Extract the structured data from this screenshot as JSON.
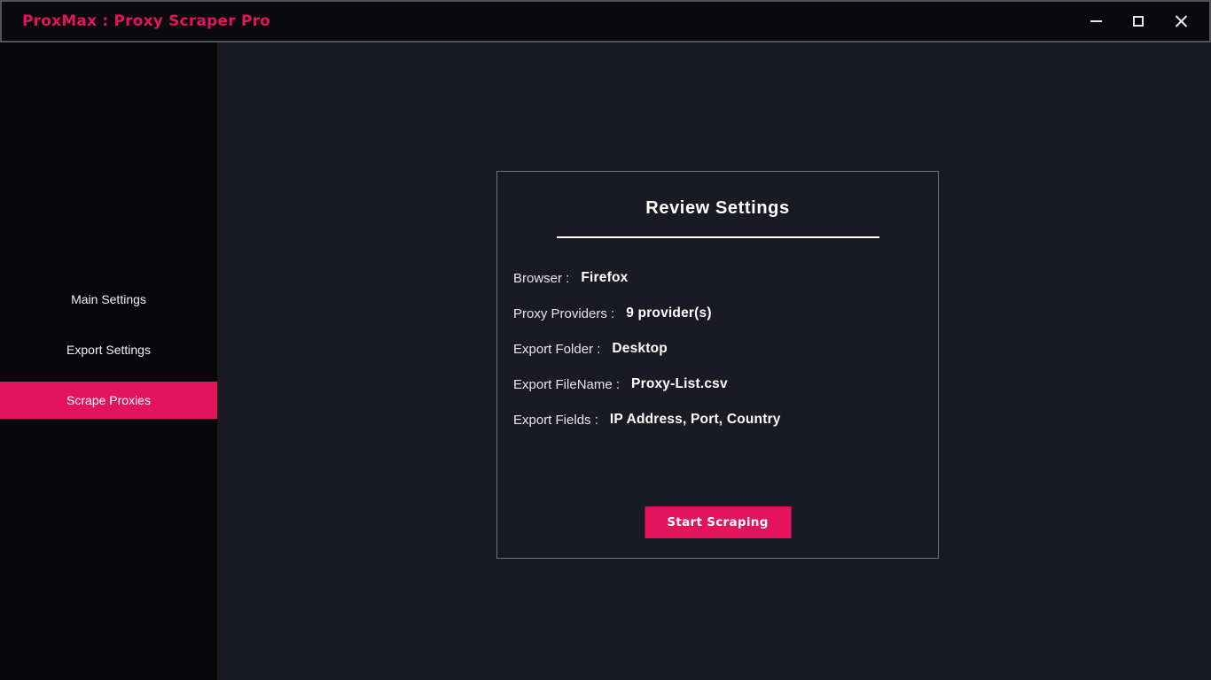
{
  "window": {
    "title": "ProxMax : Proxy Scraper Pro",
    "controls": {
      "minimize_icon": "minus-line",
      "maximize_icon": "square-outline",
      "close_icon": "x-cross"
    }
  },
  "sidebar": {
    "items": [
      {
        "label": "Main Settings",
        "active": false
      },
      {
        "label": "Export Settings",
        "active": false
      },
      {
        "label": "Scrape Proxies",
        "active": true
      }
    ]
  },
  "main": {
    "card": {
      "title": "Review Settings",
      "fields": [
        {
          "label": "Browser :",
          "value": "Firefox"
        },
        {
          "label": "Proxy Providers :",
          "value": "9 provider(s)"
        },
        {
          "label": "Export Folder :",
          "value": "Desktop"
        },
        {
          "label": "Export FileName :",
          "value": "Proxy-List.csv"
        },
        {
          "label": "Export Fields :",
          "value": "IP Address, Port, Country"
        }
      ],
      "start_button_label": "Start Scraping"
    }
  },
  "colors": {
    "accent": "#e4145c",
    "titlebar_bg": "#0a0a0e",
    "titlebar_border": "#53535a",
    "sidebar_bg": "#07070b",
    "main_bg": "#1a1a24",
    "card_border": "#73737c",
    "text_primary": "#ffffff",
    "text_secondary": "#e6e6e6"
  }
}
